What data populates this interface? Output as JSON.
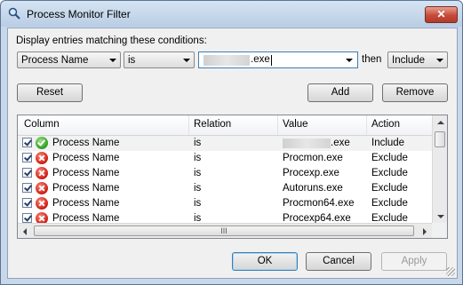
{
  "window": {
    "title": "Process Monitor Filter",
    "close_label": "✕"
  },
  "conditions": {
    "label": "Display entries matching these conditions:",
    "column_value": "Process Name",
    "relation_value": "is",
    "value_text": ".exe",
    "then_label": "then",
    "action_value": "Include"
  },
  "buttons": {
    "reset": "Reset",
    "add": "Add",
    "remove": "Remove",
    "ok": "OK",
    "cancel": "Cancel",
    "apply": "Apply"
  },
  "table": {
    "headers": [
      "Column",
      "Relation",
      "Value",
      "Action"
    ],
    "rows": [
      {
        "column": "Process Name",
        "relation": "is",
        "value": ".exe",
        "action": "Include",
        "icon": "include-check-icon"
      },
      {
        "column": "Process Name",
        "relation": "is",
        "value": "Procmon.exe",
        "action": "Exclude",
        "icon": "exclude-x-icon"
      },
      {
        "column": "Process Name",
        "relation": "is",
        "value": "Procexp.exe",
        "action": "Exclude",
        "icon": "exclude-x-icon"
      },
      {
        "column": "Process Name",
        "relation": "is",
        "value": "Autoruns.exe",
        "action": "Exclude",
        "icon": "exclude-x-icon"
      },
      {
        "column": "Process Name",
        "relation": "is",
        "value": "Procmon64.exe",
        "action": "Exclude",
        "icon": "exclude-x-icon"
      },
      {
        "column": "Process Name",
        "relation": "is",
        "value": "Procexp64.exe",
        "action": "Exclude",
        "icon": "exclude-x-icon"
      }
    ],
    "hscroll_grip": "III"
  },
  "colors": {
    "include": "#2f9a1e",
    "exclude": "#cc1a12",
    "accent": "#3c7fb1"
  }
}
